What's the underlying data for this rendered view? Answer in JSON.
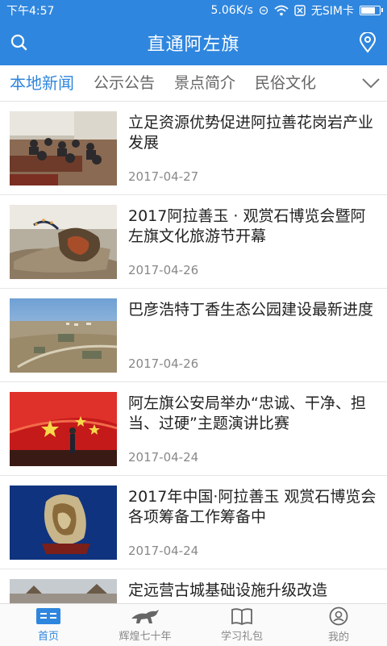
{
  "status": {
    "time": "下午4:57",
    "speed": "5.06K/s",
    "sim": "无SIM卡",
    "battery_level": 0.8
  },
  "header": {
    "title": "直通阿左旗",
    "left_icon": "search-icon",
    "right_icon": "location-icon"
  },
  "tabs": [
    "本地新闻",
    "公示公告",
    "景点简介",
    "民俗文化"
  ],
  "active_tab": 0,
  "news": [
    {
      "title": "立足资源优势促进阿拉善花岗岩产业发展",
      "date": "2017-04-27"
    },
    {
      "title": "2017阿拉善玉 · 观赏石博览会暨阿左旗文化旅游节开幕",
      "date": "2017-04-26"
    },
    {
      "title": "巴彦浩特丁香生态公园建设最新进度",
      "date": "2017-04-26"
    },
    {
      "title": "阿左旗公安局举办“忠诚、干净、担当、过硬”主题演讲比赛",
      "date": "2017-04-24"
    },
    {
      "title": "2017年中国·阿拉善玉 观赏石博览会各项筹备工作筹备中",
      "date": "2017-04-24"
    },
    {
      "title": "定远营古城基础设施升级改造",
      "date": ""
    }
  ],
  "nav": [
    {
      "label": "首页",
      "icon": "home-icon"
    },
    {
      "label": "辉煌七十年",
      "icon": "horse-icon"
    },
    {
      "label": "学习礼包",
      "icon": "book-icon"
    },
    {
      "label": "我的",
      "icon": "user-icon"
    }
  ],
  "colors": {
    "primary": "#2f86de"
  }
}
